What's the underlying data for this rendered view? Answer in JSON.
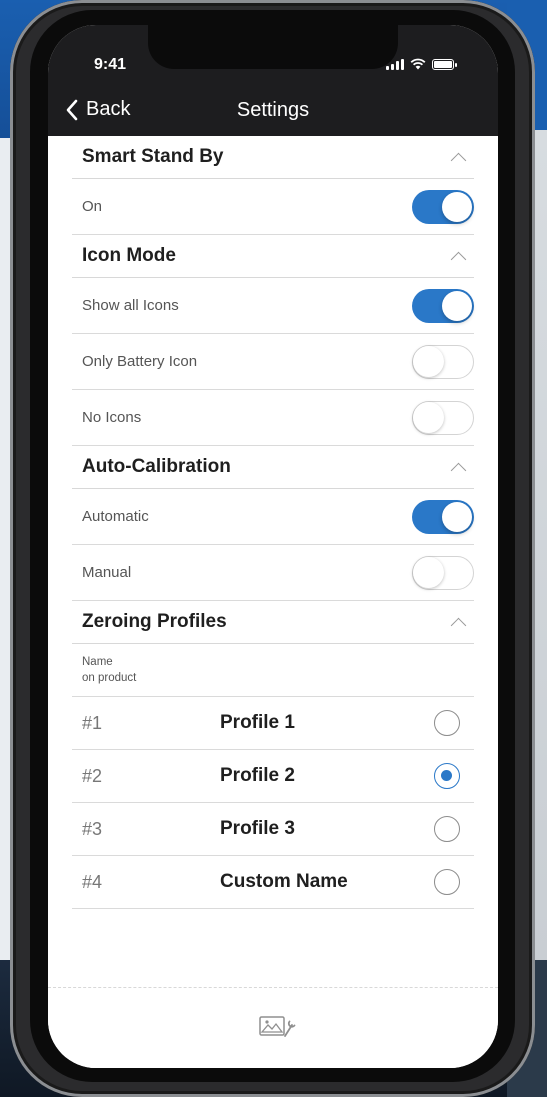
{
  "status_bar": {
    "time": "9:41"
  },
  "nav": {
    "back_label": "Back",
    "title": "Settings"
  },
  "sections": {
    "smart_stand_by": {
      "title": "Smart Stand By",
      "rows": [
        {
          "label": "On",
          "on": true
        }
      ]
    },
    "icon_mode": {
      "title": "Icon Mode",
      "rows": [
        {
          "label": "Show all Icons",
          "on": true
        },
        {
          "label": "Only Battery Icon",
          "on": false
        },
        {
          "label": "No Icons",
          "on": false
        }
      ]
    },
    "auto_calibration": {
      "title": "Auto-Calibration",
      "rows": [
        {
          "label": "Automatic",
          "on": true
        },
        {
          "label": "Manual",
          "on": false
        }
      ]
    },
    "zeroing_profiles": {
      "title": "Zeroing Profiles",
      "name_header_line1": "Name",
      "name_header_line2": "on product",
      "profiles": [
        {
          "num": "#1",
          "name": "Profile 1",
          "selected": false
        },
        {
          "num": "#2",
          "name": "Profile 2",
          "selected": true
        },
        {
          "num": "#3",
          "name": "Profile 3",
          "selected": false
        },
        {
          "num": "#4",
          "name": "Custom Name",
          "selected": false
        }
      ]
    }
  },
  "colors": {
    "accent": "#2a78c8",
    "topbar": "#1d1d1f"
  }
}
